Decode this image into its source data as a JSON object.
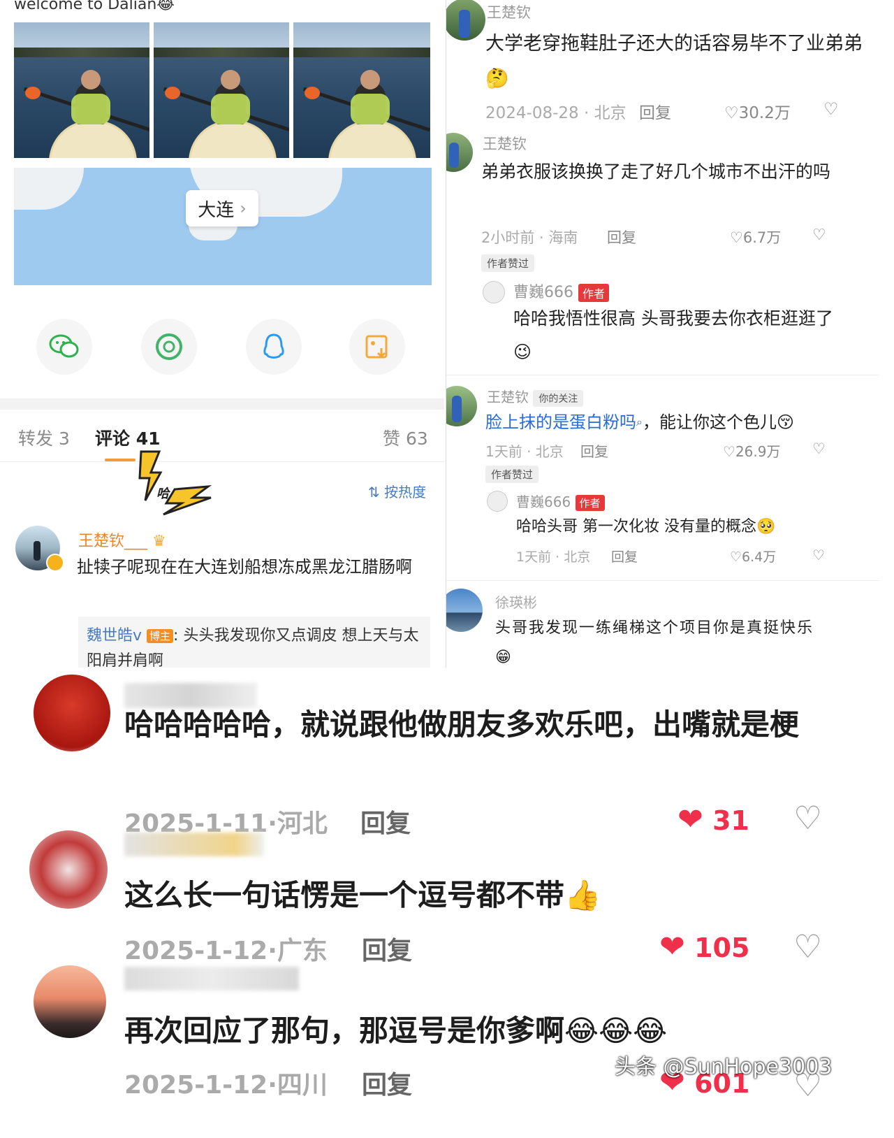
{
  "left": {
    "post_caption": "welcome to Dalian😂",
    "map_label": "大连",
    "tabs": {
      "forward": "转发 3",
      "comments": "评论 41",
      "likes": "赞 63"
    },
    "sort_label": "按热度",
    "sticker_text": "哈",
    "comment": {
      "user": "王楚钦___",
      "text": "扯犊子呢现在在大连划船想冻成黑龙江腊肠啊",
      "reply_user": "魏世皓v",
      "reply_badge": "博主",
      "reply_text": ": 头头我发现你又点调皮 想上天与太阳肩并肩啊"
    }
  },
  "right": {
    "comments": [
      {
        "user": "王楚钦",
        "text": "大学老穿拖鞋肚子还大的话容易毕不了业弟弟🤔",
        "date": "2024-08-28 · 北京",
        "reply": "回复",
        "likes": "30.2万"
      },
      {
        "user": "王楚钦",
        "text": "弟弟衣服该换换了走了好几个城市不出汗的吗",
        "date": "2小时前 · 海南",
        "reply": "回复",
        "likes": "6.7万",
        "tag": "作者赞过",
        "sub_user": "曹巍666",
        "sub_badge": "作者",
        "sub_text": "哈哈我悟性很高 头哥我要去你衣柜逛逛了😉"
      },
      {
        "user": "王楚钦",
        "follow_tag": "你的关注",
        "text_link": "脸上抹的是蛋白粉吗",
        "text_rest": "，能让你这个色儿😚",
        "date": "1天前 · 北京",
        "reply": "回复",
        "likes": "26.9万",
        "tag": "作者赞过",
        "sub_user": "曹巍666",
        "sub_badge": "作者",
        "sub_text": "哈哈头哥 第一次化妆 没有量的概念🥺",
        "sub_date": "1天前 · 北京",
        "sub_reply": "回复",
        "sub_likes": "6.4万"
      },
      {
        "user": "徐瑛彬",
        "text": "头哥我发现一练绳梯这个项目你是真挺快乐😁"
      }
    ]
  },
  "bottom": {
    "comments": [
      {
        "text": "哈哈哈哈哈，就说跟他做朋友多欢乐吧，出嘴就是梗",
        "date": "2025-1-11·河北",
        "reply": "回复",
        "likes": "31"
      },
      {
        "text": "这么长一句话愣是一个逗号都不带👍",
        "date": "2025-1-12·广东",
        "reply": "回复",
        "likes": "105"
      },
      {
        "text": "再次回应了那句，那逗号是你爹啊😂😂😂",
        "date": "2025-1-12·四川",
        "reply": "回复",
        "likes": "601"
      }
    ],
    "watermark": "头条 @SunHope3003"
  },
  "colors": {
    "accent_blue": "#2b6bd6",
    "like_red": "#f0304a",
    "badge_red": "#e6393b",
    "weibo_orange": "#e8872a"
  }
}
